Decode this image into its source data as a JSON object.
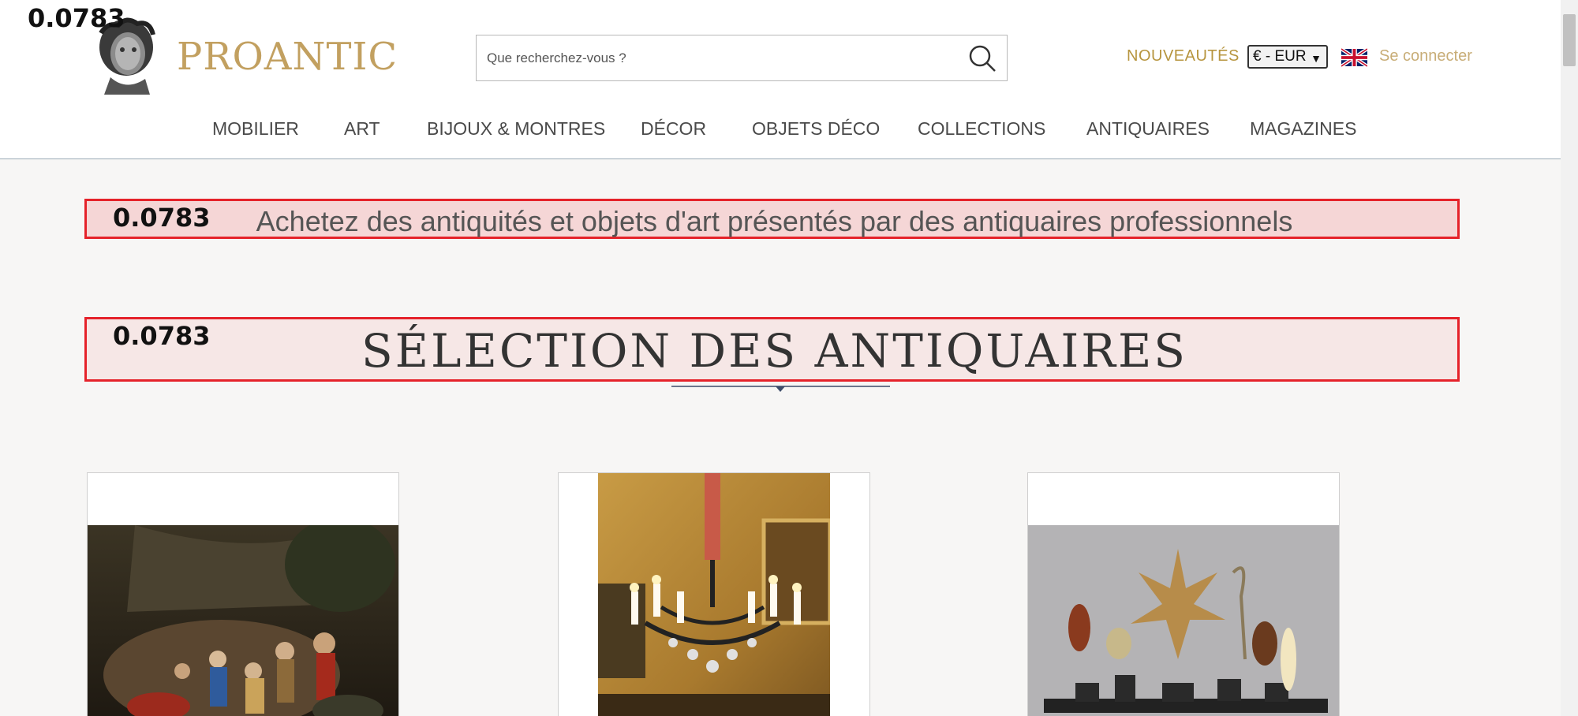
{
  "scores": {
    "top": "0.0783",
    "tagline": "0.0783",
    "title": "0.0783"
  },
  "header": {
    "logo_text": "PROANTIC",
    "search": {
      "placeholder": "Que recherchez-vous ?"
    },
    "nouveautes": "NOUVEAUTÉS",
    "currency": {
      "selected": "€ - EUR"
    },
    "language_flag": "uk-flag-icon",
    "login": "Se connecter"
  },
  "nav": {
    "items": [
      {
        "label": "MOBILIER"
      },
      {
        "label": "ART"
      },
      {
        "label": "BIJOUX & MONTRES"
      },
      {
        "label": "DÉCOR"
      },
      {
        "label": "OBJETS DÉCO"
      },
      {
        "label": "COLLECTIONS"
      },
      {
        "label": "ANTIQUAIRES"
      },
      {
        "label": "MAGAZINES"
      }
    ]
  },
  "main": {
    "tagline": "Achetez des antiquités et objets d'art présentés par des antiquaires professionnels",
    "section_title": "SÉLECTION DES ANTIQUAIRES"
  },
  "colors": {
    "brand_gold": "#c2a060",
    "nav_text": "#4a4a4a",
    "highlight_red": "#e5222a",
    "page_bg": "#f7f6f5"
  }
}
